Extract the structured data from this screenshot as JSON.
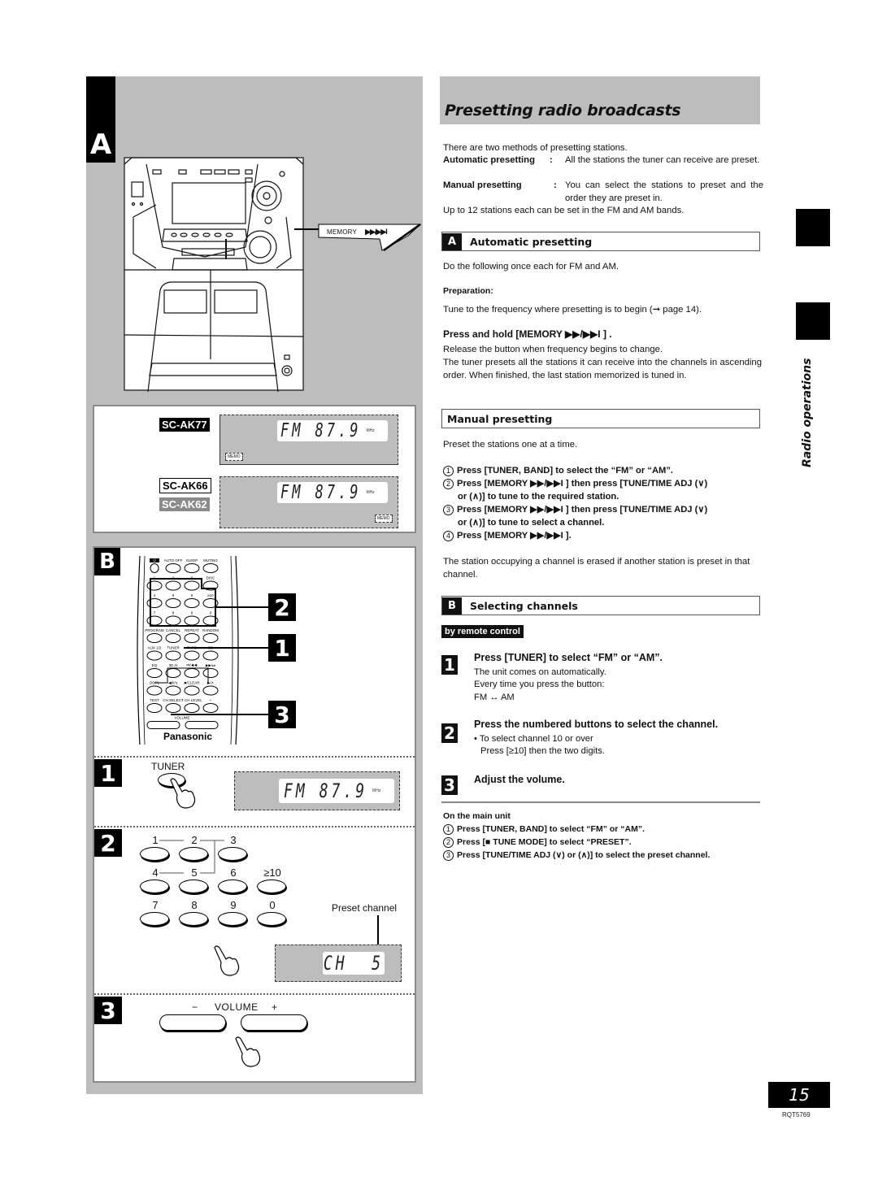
{
  "page": {
    "title": "Presetting radio broadcasts",
    "side_label": "Radio operations",
    "page_number": "15",
    "doc_code": "RQT5769"
  },
  "intro": {
    "lead": "There are two methods of presetting stations.",
    "methods": [
      {
        "term": "Automatic presetting",
        "colon": ":",
        "desc": "All the stations the tuner can receive are preset."
      },
      {
        "term": "Manual presetting",
        "colon": ":",
        "desc": "You can select the stations to preset and the order they are preset in."
      }
    ],
    "limit": "Up to 12 stations each can be set in the FM and AM bands."
  },
  "section_a": {
    "letter": "A",
    "heading": "Automatic presetting",
    "lead": "Do the following once each for FM and AM.",
    "prep_label": "Preparation:",
    "prep_text": "Tune to the frequency where presetting is to begin (➞ page 14).",
    "step_title": "Press and hold [MEMORY ▶▶/▶▶I ] .",
    "step_body": [
      "Release the button when frequency begins to change.",
      "The tuner presets all the stations it can receive into the channels in ascending order. When finished, the last station memorized is tuned in."
    ]
  },
  "manual": {
    "heading": "Manual presetting",
    "lead": "Preset the stations one at a time.",
    "steps": [
      {
        "num": "1",
        "line1": "Press [TUNER, BAND] to select the “FM” or “AM”.",
        "line2": ""
      },
      {
        "num": "2",
        "line1": "Press [MEMORY ▶▶/▶▶I ] then press  [TUNE/TIME ADJ (∨)",
        "line2": "or (∧)] to tune to the required station."
      },
      {
        "num": "3",
        "line1": "Press [MEMORY ▶▶/▶▶I ] then press  [TUNE/TIME ADJ (∨)",
        "line2": "or (∧)] to tune to select a channel."
      },
      {
        "num": "4",
        "line1": "Press [MEMORY ▶▶/▶▶I ].",
        "line2": ""
      }
    ],
    "note": "The station occupying a channel is erased if another station is preset in that channel."
  },
  "section_b": {
    "letter": "B",
    "heading": "Selecting channels",
    "chip": "by remote control",
    "steps": [
      {
        "num": "1",
        "title": "Press [TUNER] to select “FM” or “AM”.",
        "body": [
          "The unit comes on automatically.",
          "Every time you press the button:",
          "FM ↔ AM"
        ]
      },
      {
        "num": "2",
        "title": "Press the numbered buttons to select the channel.",
        "body": [
          "• To select channel 10 or over",
          "Press [≥10] then the two digits."
        ]
      },
      {
        "num": "3",
        "title": "Adjust the volume.",
        "body": []
      }
    ],
    "main_unit_label": "On the main unit",
    "main_unit_steps": [
      {
        "num": "1",
        "text": "Press [TUNER, BAND] to select “FM” or “AM”."
      },
      {
        "num": "2",
        "text": "Press [■ TUNE MODE] to select “PRESET”."
      },
      {
        "num": "3",
        "text": "Press [TUNE/TIME ADJ (∨) or (∧)] to select the preset channel."
      }
    ]
  },
  "illustration": {
    "tag_a": "A",
    "tag_b": "B",
    "memory_label": "MEMORY",
    "memory_arrows": "▶▶/▶▶I",
    "models": {
      "ak77": "SC-AK77",
      "ak66": "SC-AK66",
      "ak62": "SC-AK62"
    },
    "display_band": "FM",
    "display_freq": "87.9",
    "display_unit": "MHz",
    "memo": "MEMO",
    "remote_brand": "Panasonic",
    "remote_labels": {
      "row0": [
        "⏻",
        "AUTO OFF",
        "SLEEP",
        "MUTING"
      ],
      "row1": [
        "1",
        "2",
        "3",
        "DISC"
      ],
      "row2": [
        "4",
        "5",
        "6",
        "≥10"
      ],
      "row3": [
        "7",
        "8",
        "9",
        "0"
      ],
      "row4": [
        "PROGRAM",
        "CANCEL",
        "REPEAT",
        "RANDOM"
      ],
      "row5": [
        "AUX 1/2",
        "TUNER",
        "TAPE",
        "CD"
      ],
      "row6": [
        "EQ",
        "3D AI",
        "⏮/◀◀",
        "▶▶/⏭"
      ],
      "row7": [
        "DDPL",
        "◀/II/∨",
        "■/CLEAR",
        "▶/∧"
      ],
      "row8": [
        "TEST",
        "CH SELECT",
        "− CH LEVEL",
        "+"
      ],
      "volume": "VOLUME"
    },
    "callouts": [
      "2",
      "1",
      "3"
    ],
    "step1_button": "TUNER",
    "keypad": [
      "1",
      "2",
      "3",
      "4",
      "5",
      "6",
      "≥10",
      "7",
      "8",
      "9",
      "0"
    ],
    "preset_channel_label": "Preset channel",
    "ch_display": "CH  5",
    "volume_minus": "−",
    "volume_label": "VOLUME",
    "volume_plus": "+"
  }
}
